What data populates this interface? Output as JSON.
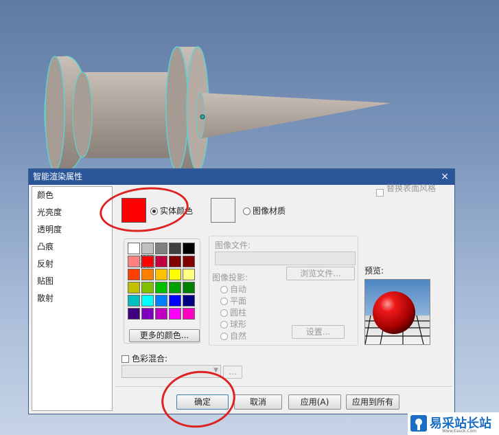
{
  "dialog": {
    "title": "智能渲染属性",
    "close_symbol": "×"
  },
  "sidebar": {
    "items": [
      "颜色",
      "光亮度",
      "透明度",
      "凸痕",
      "反射",
      "贴图",
      "散射"
    ]
  },
  "panel": {
    "replace_surface_style": "替换表面风格",
    "solid_color_label": "实体颜色",
    "image_material_label": "图像材质",
    "more_colors_button": "更多的颜色...",
    "image_file_label": "图像文件:",
    "browse_button": "浏览文件...",
    "image_projection_label": "图像投影:",
    "projection_options": [
      "自动",
      "平面",
      "圆柱",
      "球形",
      "自然"
    ],
    "settings_button": "设置...",
    "preview_label": "预览:",
    "color_blend_label": "色彩混合:",
    "ellipsis_button": "...",
    "palette_colors": [
      "#ffffff",
      "#c0c0c0",
      "#808080",
      "#404040",
      "#000000",
      "#ff8080",
      "#ff0000",
      "#c00040",
      "#800000",
      "#800000",
      "#ff4000",
      "#ff8000",
      "#ffc000",
      "#ffff00",
      "#ffff80",
      "#c0c000",
      "#80c000",
      "#00c000",
      "#00a000",
      "#008000",
      "#00c0c0",
      "#00ffff",
      "#0080ff",
      "#0000ff",
      "#000080",
      "#400080",
      "#8000c0",
      "#c000c0",
      "#ff00ff",
      "#ff00c0"
    ]
  },
  "footer": {
    "ok": "确定",
    "cancel": "取消",
    "apply": "应用(A)",
    "apply_all": "应用到所有"
  },
  "watermark": {
    "text": "易采站长站",
    "subtext": "Www.Easck.Com"
  }
}
